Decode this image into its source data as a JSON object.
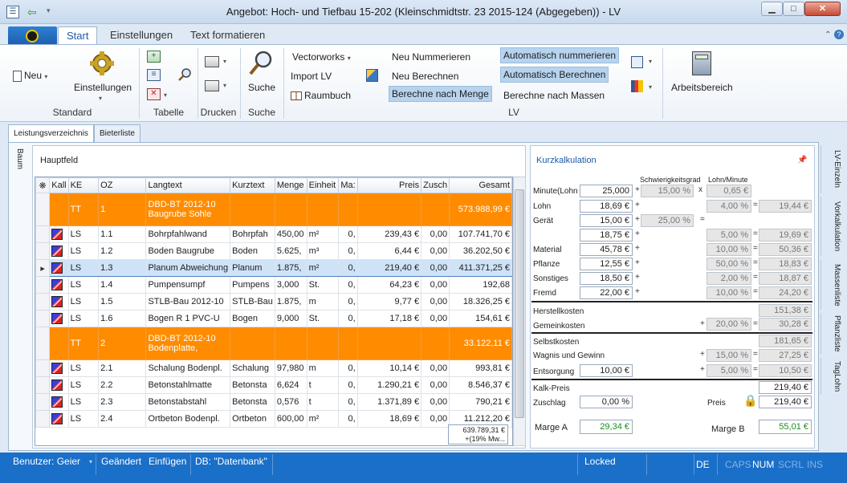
{
  "window": {
    "title": "Angebot: Hoch- und Tiefbau 15-202 (Kleinschmidtstr. 23 2015-124 (Abgegeben)) - LV"
  },
  "ribbon_tabs": [
    "Start",
    "Einstellungen",
    "Text formatieren"
  ],
  "ribbon": {
    "neu": "Neu",
    "einstellungen": "Einstellungen",
    "suche": "Suche",
    "vectorworks": "Vectorworks",
    "import_lv": "Import LV",
    "raumbuch": "Raumbuch",
    "neu_nummerieren": "Neu Nummerieren",
    "neu_berechnen": "Neu Berechnen",
    "berechne_menge": "Berechne nach Menge",
    "auto_nummerieren": "Automatisch nummerieren",
    "auto_berechnen": "Automatisch Berechnen",
    "berechne_massen": "Berechne nach Massen",
    "arbeitsbereich": "Arbeitsbereich",
    "groups": {
      "standard": "Standard",
      "tabelle": "Tabelle",
      "drucken": "Drucken",
      "suche": "Suche",
      "lv": "LV"
    }
  },
  "doc_tabs": [
    "Leistungsverzeichnis",
    "Bieterliste"
  ],
  "left_tab": "Baum",
  "hauptfeld": {
    "title": "Hauptfeld",
    "columns": [
      "Kall",
      "KE",
      "OZ",
      "Langtext",
      "Kurztext",
      "Menge",
      "Einheit",
      "Ma:",
      "Preis",
      "Zusch",
      "Gesamt"
    ],
    "groups": [
      {
        "ke": "TT",
        "oz": "1",
        "langtext": "DBD-BT 2012-10",
        "langtext2": "Baugrube Sohle",
        "gesamt": "573.988,99 €"
      },
      {
        "ke": "TT",
        "oz": "2",
        "langtext": "DBD-BT 2012-10",
        "langtext2": "Bodenplatte,",
        "gesamt": "33.122,11 €"
      }
    ],
    "rows": [
      {
        "ke": "LS",
        "oz": "1.1",
        "langtext": "Bohrpfahlwand",
        "kurztext": "Bohrpfah",
        "menge": "450,00",
        "einheit": "m²",
        "ma": "0,",
        "preis": "239,43 €",
        "zusch": "0,00",
        "gesamt": "107.741,70 €"
      },
      {
        "ke": "LS",
        "oz": "1.2",
        "langtext": "Boden Baugrube",
        "kurztext": "Boden",
        "menge": "5.625,",
        "einheit": "m³",
        "ma": "0,",
        "preis": "6,44 €",
        "zusch": "0,00",
        "gesamt": "36.202,50 €"
      },
      {
        "ke": "LS",
        "oz": "1.3",
        "langtext": "Planum Abweichung",
        "kurztext": "Planum",
        "menge": "1.875,",
        "einheit": "m²",
        "ma": "0,",
        "preis": "219,40 €",
        "zusch": "0,00",
        "gesamt": "411.371,25 €"
      },
      {
        "ke": "LS",
        "oz": "1.4",
        "langtext": "Pumpensumpf",
        "kurztext": "Pumpens",
        "menge": "3,000",
        "einheit": "St.",
        "ma": "0,",
        "preis": "64,23 €",
        "zusch": "0,00",
        "gesamt": "192,68"
      },
      {
        "ke": "LS",
        "oz": "1.5",
        "langtext": "STLB-Bau 2012-10",
        "kurztext": "STLB-Bau",
        "menge": "1.875,",
        "einheit": "m",
        "ma": "0,",
        "preis": "9,77 €",
        "zusch": "0,00",
        "gesamt": "18.326,25 €"
      },
      {
        "ke": "LS",
        "oz": "1.6",
        "langtext": "Bogen R 1 PVC-U",
        "kurztext": "Bogen",
        "menge": "9,000",
        "einheit": "St.",
        "ma": "0,",
        "preis": "17,18 €",
        "zusch": "0,00",
        "gesamt": "154,61 €"
      },
      {
        "ke": "LS",
        "oz": "2.1",
        "langtext": "Schalung Bodenpl.",
        "kurztext": "Schalung",
        "menge": "97,980",
        "einheit": "m",
        "ma": "0,",
        "preis": "10,14 €",
        "zusch": "0,00",
        "gesamt": "993,81 €"
      },
      {
        "ke": "LS",
        "oz": "2.2",
        "langtext": "Betonstahlmatte",
        "kurztext": "Betonsta",
        "menge": "6,624",
        "einheit": "t",
        "ma": "0,",
        "preis": "1.290,21 €",
        "zusch": "0,00",
        "gesamt": "8.546,37 €"
      },
      {
        "ke": "LS",
        "oz": "2.3",
        "langtext": "Betonstabstahl",
        "kurztext": "Betonsta",
        "menge": "0,576",
        "einheit": "t",
        "ma": "0,",
        "preis": "1.371,89 €",
        "zusch": "0,00",
        "gesamt": "790,21 €"
      },
      {
        "ke": "LS",
        "oz": "2.4",
        "langtext": "Ortbeton Bodenpl.",
        "kurztext": "Ortbeton",
        "menge": "600,00",
        "einheit": "m²",
        "ma": "0,",
        "preis": "18,69 €",
        "zusch": "0,00",
        "gesamt": "11.212,20 €"
      }
    ],
    "sum_line1": "639.789,31 €",
    "sum_line2": "+(19% Mw..."
  },
  "kurz": {
    "title": "Kurzkalkulation",
    "hdr_schwierig": "Schwierigkeitsgrad",
    "hdr_lohnmin": "Lohn/Minute",
    "minute_label": "Minute(Lohn",
    "minute": "25,000",
    "minute_s": "15,00 %",
    "minute_l": "0,65 €",
    "lohn_label": "Lohn",
    "lohn": "18,69 €",
    "lohn_p": "4,00 %",
    "lohn_r": "19,44 €",
    "geraet_label": "Gerät",
    "geraet": "15,00 €",
    "geraet_s": "25,00 %",
    "geraet2": "18,75 €",
    "geraet_p": "5,00 %",
    "geraet_r": "19,69 €",
    "material_label": "Material",
    "material": "45,78 €",
    "material_p": "10,00 %",
    "material_r": "50,36 €",
    "pflanze_label": "Pflanze",
    "pflanze": "12,55 €",
    "pflanze_p": "50,00 %",
    "pflanze_r": "18,83 €",
    "sonstiges_label": "Sonstiges",
    "sonstiges": "18,50 €",
    "sonstiges_p": "2,00 %",
    "sonstiges_r": "18,87 €",
    "fremd_label": "Fremd",
    "fremd": "22,00 €",
    "fremd_p": "10,00 %",
    "fremd_r": "24,20 €",
    "herstell_label": "Herstellkosten",
    "herstell": "151,38 €",
    "gemein_label": "Gemeinkosten",
    "gemein_p": "20,00 %",
    "gemein": "30,28 €",
    "selbst_label": "Selbstkosten",
    "selbst": "181,65 €",
    "wagnis_label": "Wagnis und Gewinn",
    "wagnis_p": "15,00 %",
    "wagnis": "27,25 €",
    "entsorgung_label": "Entsorgung",
    "entsorgung": "10,00 €",
    "entsorgung_p": "5,00 %",
    "entsorgung_r": "10,50 €",
    "kalk_label": "Kalk-Preis",
    "kalk": "219,40 €",
    "zuschlag_label": "Zuschlag",
    "zuschlag": "0,00 %",
    "preis_label": "Preis",
    "preis": "219,40 €",
    "marge_a_label": "Marge A",
    "marge_a": "29,34 €",
    "marge_b_label": "Marge B",
    "marge_b": "55,01 €"
  },
  "right_tabs": [
    "LV-Einzeln",
    "Vorkalkulation",
    "Massenliste",
    "Pflanzliste",
    "TagLohn"
  ],
  "status": {
    "benutzer": "Benutzer: Geier",
    "geaendert": "Geändert",
    "einfuegen": "Einfügen",
    "db": "DB: \"Datenbank\"",
    "locked": "Locked",
    "lang": "DE",
    "caps": "CAPS",
    "num": "NUM",
    "scrl": "SCRL",
    "ins": "INS"
  }
}
